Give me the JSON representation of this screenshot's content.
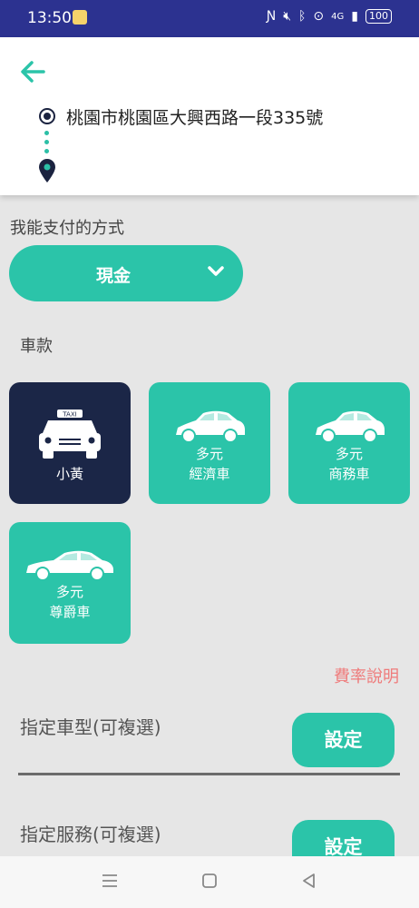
{
  "status_bar": {
    "time": "13:50",
    "icons": [
      "nfc-icon",
      "mute-icon",
      "bluetooth-icon",
      "location-icon",
      "signal-icon"
    ],
    "network": "4G",
    "battery": "100"
  },
  "header": {
    "origin_address": "桃園市桃園區大興西路一段335號"
  },
  "payment": {
    "label": "我能支付的方式",
    "selected": "現金"
  },
  "vehicle": {
    "label": "車款",
    "options": [
      {
        "line1": "小黃",
        "line2": "",
        "selected": true
      },
      {
        "line1": "多元",
        "line2": "經濟車",
        "selected": false
      },
      {
        "line1": "多元",
        "line2": "商務車",
        "selected": false
      },
      {
        "line1": "多元",
        "line2": "尊爵車",
        "selected": false
      }
    ]
  },
  "rate_info": "費率說明",
  "car_type": {
    "label": "指定車型(可複選)",
    "button": "設定"
  },
  "service": {
    "label": "指定服務(可複選)",
    "button": "設定"
  },
  "colors": {
    "accent": "#2bc4a9",
    "selected_card": "#1b2647",
    "status_bar": "#2c3290",
    "rate_link": "#ef7b7b"
  }
}
